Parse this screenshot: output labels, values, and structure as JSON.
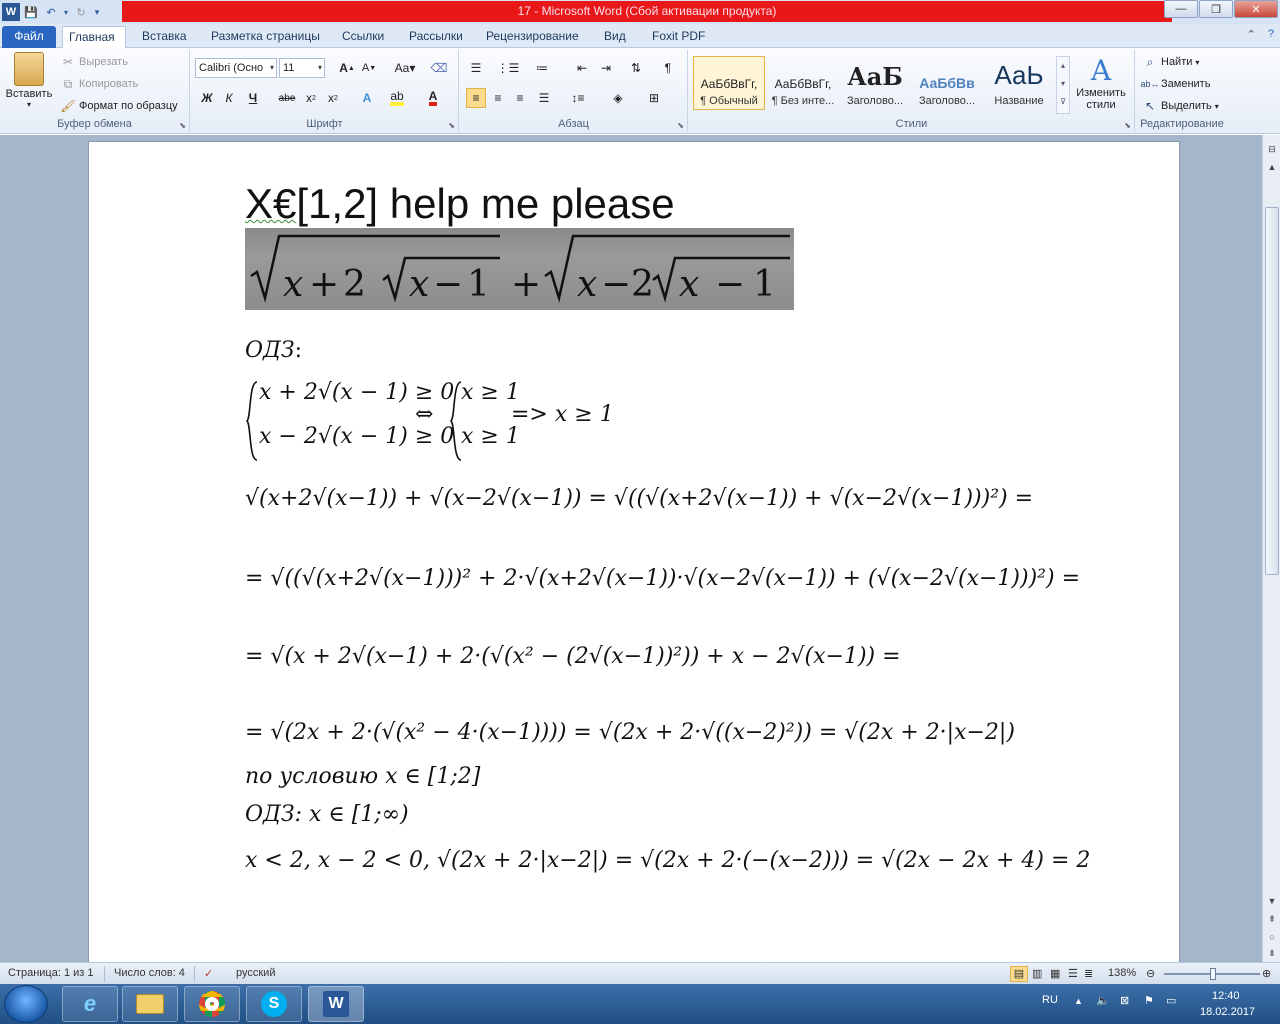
{
  "window": {
    "title": "17 - Microsoft Word (Сбой активации продукта)",
    "min": "—",
    "max": "❐",
    "close": "✕"
  },
  "tabs": [
    {
      "label": "Файл"
    },
    {
      "label": "Главная"
    },
    {
      "label": "Вставка"
    },
    {
      "label": "Разметка страницы"
    },
    {
      "label": "Ссылки"
    },
    {
      "label": "Рассылки"
    },
    {
      "label": "Рецензирование"
    },
    {
      "label": "Вид"
    },
    {
      "label": "Foxit PDF"
    }
  ],
  "ribbon": {
    "clipboard": {
      "paste": "Вставить",
      "cut": "Вырезать",
      "copy": "Копировать",
      "format_painter": "Формат по образцу",
      "label": "Буфер обмена"
    },
    "font": {
      "name": "Calibri (Осно",
      "size": "11",
      "label": "Шрифт",
      "bold": "Ж",
      "italic": "К",
      "underline": "Ч",
      "strike": "abe"
    },
    "paragraph": {
      "label": "Абзац"
    },
    "styles": {
      "label": "Стили",
      "items": [
        {
          "sample": "АаБбВвГг,",
          "name": "¶ Обычный"
        },
        {
          "sample": "АаБбВвГг,",
          "name": "¶ Без инте..."
        },
        {
          "sample": "АаБ",
          "name": "Заголово..."
        },
        {
          "sample": "АаБбВв",
          "name": "Заголово..."
        },
        {
          "sample": "АаЬ",
          "name": "Название"
        }
      ],
      "change": "Изменить стили"
    },
    "editing": {
      "label": "Редактирование",
      "find": "Найти",
      "replace": "Заменить",
      "select": "Выделить"
    }
  },
  "document": {
    "title_prefix": "X€",
    "title_rest": "[1,2] help me please",
    "math": {
      "odz_label": "ОДЗ",
      "colon": ":",
      "cond1": "x + 2√(x − 1) ≥ 0",
      "cond2": "x − 2√(x − 1) ≥ 0",
      "equiv": "⇔",
      "cond3": "x ≥ 1",
      "cond4": "x ≥ 1",
      "implies": "=> x ≥ 1",
      "line4": "√(x+2√(x−1)) + √(x−2√(x−1)) = √((√(x+2√(x−1)) + √(x−2√(x−1)))²) =",
      "line5": "= √((√(x+2√(x−1)))² + 2·√(x+2√(x−1))·√(x−2√(x−1)) + (√(x−2√(x−1)))²) =",
      "line6": "= √(x + 2√(x−1) + 2·(√(x² − (2√(x−1))²)) + x − 2√(x−1)) =",
      "line7": "= √(2x + 2·(√(x² − 4·(x−1)))) = √(2x + 2·√((x−2)²)) = √(2x + 2·|x−2|)",
      "line8": "по условию x ∈ [1;2]",
      "line9": "ОДЗ:    x ∈ [1;∞)",
      "line10": "x < 2,    x − 2 < 0,    √(2x + 2·|x−2|) = √(2x + 2·(−(x−2))) = √(2x − 2x + 4) = 2"
    }
  },
  "status": {
    "page": "Страница: 1 из 1",
    "words": "Число слов: 4",
    "language": "русский",
    "zoom": "138%"
  },
  "taskbar": {
    "lang": "RU",
    "time": "12:40",
    "date": "18.02.2017"
  },
  "colors": {
    "title_bar_alert": "#e81818",
    "file_tab": "#2a66c1",
    "taskbar": "#214f86"
  }
}
